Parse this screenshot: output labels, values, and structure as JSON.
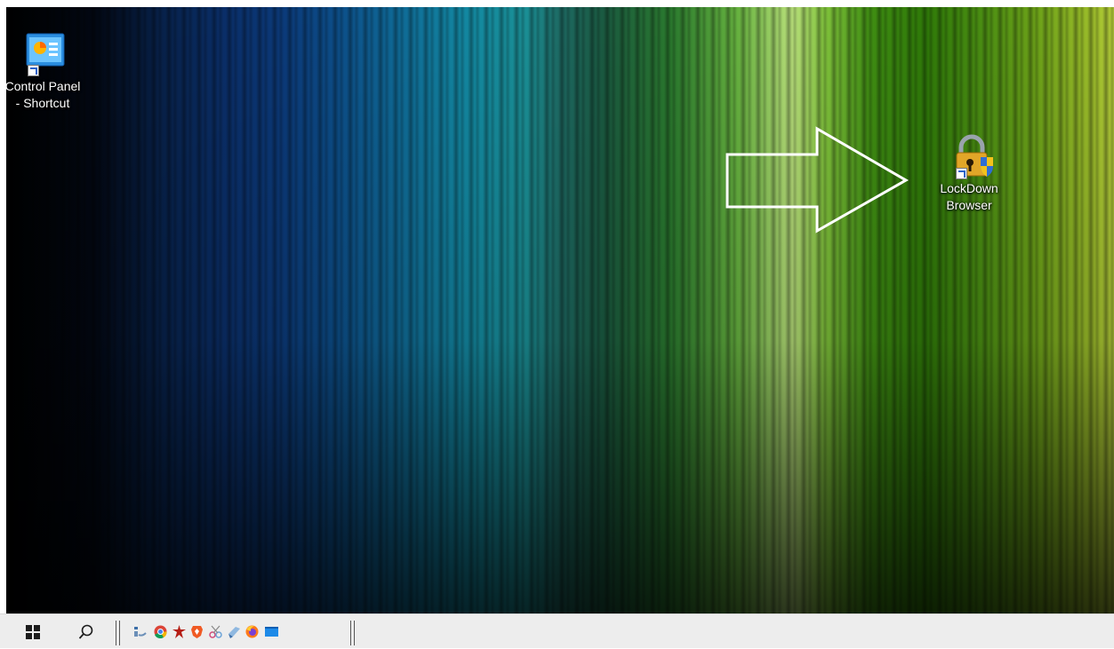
{
  "desktop": {
    "icons": [
      {
        "label_line1": "Control Panel",
        "label_line2": "- Shortcut",
        "icon": "control-panel-icon"
      },
      {
        "label_line1": "LockDown",
        "label_line2": "Browser",
        "icon": "lockdown-browser-icon"
      }
    ],
    "annotation": {
      "icon": "outline-right-arrow",
      "color": "#ffffff"
    }
  },
  "taskbar": {
    "start": {
      "icon": "windows-logo-icon"
    },
    "search": {
      "icon": "search-icon"
    },
    "pinned_apps": [
      {
        "name": "file-explorer-icon"
      },
      {
        "name": "chrome-icon"
      },
      {
        "name": "red-app-icon"
      },
      {
        "name": "brave-icon"
      },
      {
        "name": "snipping-tool-icon"
      },
      {
        "name": "paint-app-icon"
      },
      {
        "name": "firefox-icon"
      },
      {
        "name": "desktop-app-icon"
      }
    ]
  },
  "colors": {
    "taskbar_bg": "#ededed",
    "icon_text": "#ffffff"
  }
}
